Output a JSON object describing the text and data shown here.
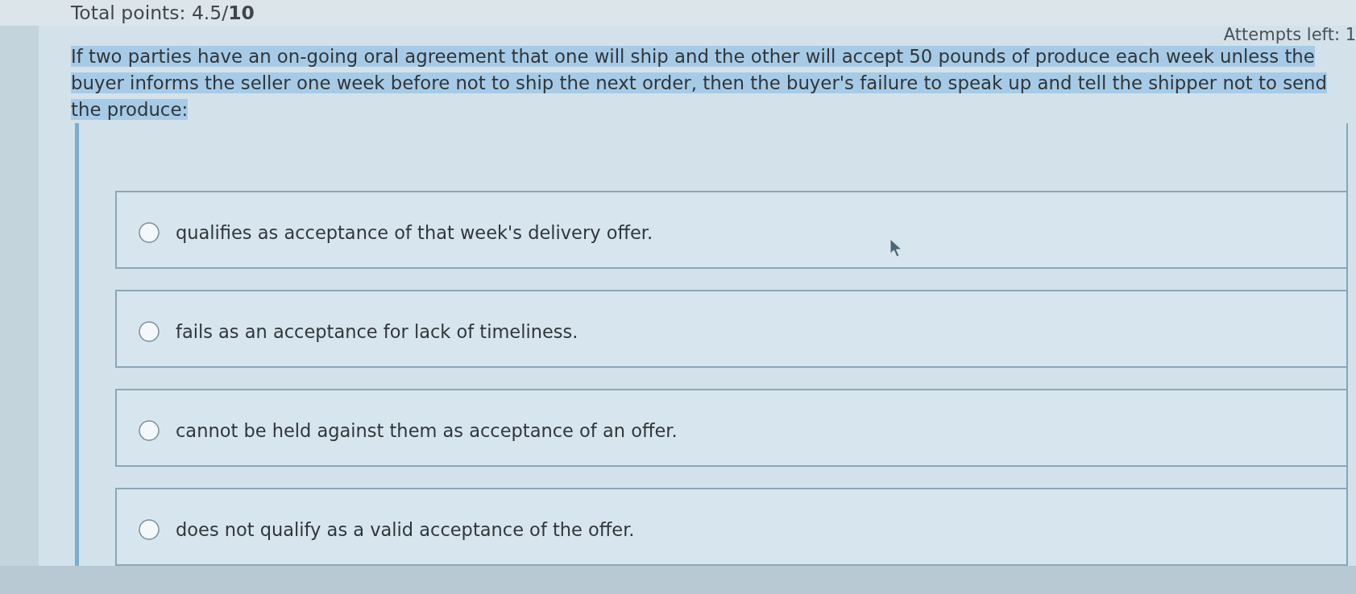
{
  "header": {
    "total_points": "Total points: 4.5/**10**",
    "attempts_left": "Attempts left: 1"
  },
  "question": {
    "text": "If two parties have an on-going oral agreement that one will ship and the other will accept 50 pounds of produce each week unless the buyer informs the seller one week before not to ship the next order, then the buyer's failure to speak up and tell the shipper not to send the produce:",
    "highlighted": true
  },
  "options": [
    {
      "label": "qualifies as acceptance of that week's delivery offer.",
      "selected": false
    },
    {
      "label": "fails as an acceptance for lack of timeliness.",
      "selected": false
    },
    {
      "label": "cannot be held against them as acceptance of an offer.",
      "selected": false
    },
    {
      "label": "does not qualify as a valid acceptance of the offer.",
      "selected": false
    }
  ]
}
